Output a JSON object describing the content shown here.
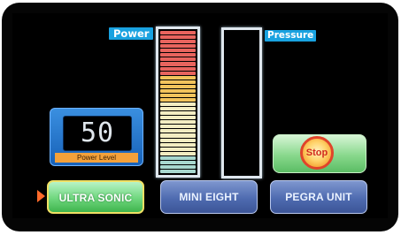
{
  "gauges": {
    "power_label": "Power",
    "pressure_label": "Pressure",
    "power_fill": 1.0,
    "pressure_fill": 0.0,
    "power_segment_count": 32,
    "power_segment_colors": {
      "low": "#a8d8cf",
      "mid": "#f3edc2",
      "upper": "#f2c45c",
      "high": "#e8645e"
    }
  },
  "power_level": {
    "value": "50",
    "caption": "Power Level"
  },
  "stop": {
    "label": "Stop"
  },
  "modes": {
    "ultra_sonic": "ULTRA SONIC",
    "mini_eight": "MINI EIGHT",
    "pegra_unit": "PEGRA UNIT",
    "selected": "ultra_sonic"
  }
}
